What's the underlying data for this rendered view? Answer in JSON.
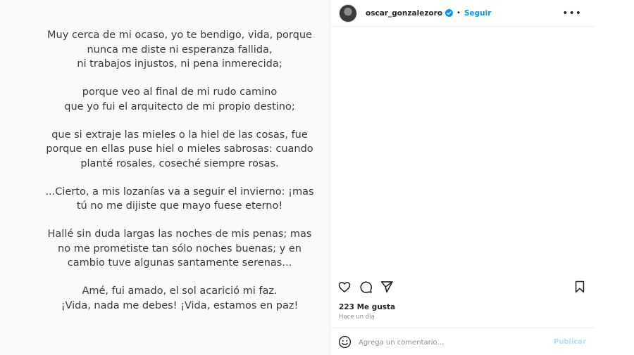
{
  "post": {
    "poem": [
      [
        "Muy cerca de mi ocaso, yo te bendigo, vida, porque",
        "nunca me diste ni esperanza fallida,",
        "ni trabajos injustos, ni pena inmerecida;"
      ],
      [
        "porque veo al final de mi rudo camino",
        "que yo fui el arquitecto de mi propio destino;"
      ],
      [
        "que si extraje las mieles o la hiel de las cosas, fue",
        "porque en ellas puse hiel o mieles sabrosas: cuando",
        "planté rosales, coseché siempre rosas."
      ],
      [
        "...Cierto, a mis lozanías va a seguir el invierno: ¡mas",
        "tú no me dijiste que mayo fuese eterno!"
      ],
      [
        "Hallé sin duda largas las noches de mis penas; mas",
        "no me prometiste tan sólo noches buenas; y en",
        "cambio tuve algunas santamente serenas..."
      ],
      [
        "Amé, fui amado, el sol acarició mi faz.",
        "¡Vida, nada me debes! ¡Vida, estamos en paz!"
      ]
    ]
  },
  "header": {
    "username": "oscar_gonzalezoro",
    "separator": "•",
    "follow_label": "Seguir",
    "more_label": "•••",
    "verified_color": "#0095f6"
  },
  "actions": {
    "icons": [
      "heart-icon",
      "comment-icon",
      "share-icon",
      "bookmark-icon"
    ]
  },
  "stats": {
    "likes": "223 Me gusta",
    "time": "Hace un día"
  },
  "comment": {
    "placeholder": "Agrega un comentario...",
    "publish_label": "Publicar"
  }
}
